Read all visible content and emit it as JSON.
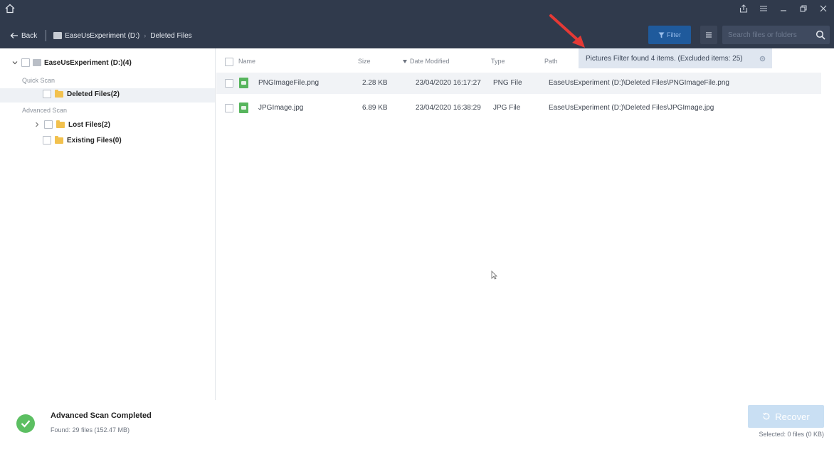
{
  "titlebar": {
    "home_icon": "home-icon",
    "controls": [
      "share-icon",
      "menu-icon",
      "minimize-icon",
      "restore-icon",
      "close-icon"
    ]
  },
  "nav": {
    "back_label": "Back",
    "drive_label": "EaseUsExperiment (D:)",
    "folder_label": "Deleted Files",
    "filter_label": "Filter",
    "search_placeholder": "Search files or folders"
  },
  "banner": {
    "text": "Pictures Filter found 4 items. (Excluded items: 25)"
  },
  "sidebar": {
    "root_label": "EaseUsExperiment (D:)(4)",
    "quick_scan_label": "Quick Scan",
    "deleted_files_label": "Deleted Files(2)",
    "advanced_scan_label": "Advanced Scan",
    "lost_files_label": "Lost Files(2)",
    "existing_files_label": "Existing Files(0)"
  },
  "table": {
    "headers": {
      "name": "Name",
      "size": "Size",
      "date": "Date Modified",
      "type": "Type",
      "path": "Path"
    },
    "rows": [
      {
        "name": "PNGImageFile.png",
        "size": "2.28 KB",
        "date": "23/04/2020 16:17:27",
        "type": "PNG File",
        "path": "EaseUsExperiment (D:)\\Deleted Files\\PNGImageFile.png"
      },
      {
        "name": "JPGImage.jpg",
        "size": "6.89 KB",
        "date": "23/04/2020 16:38:29",
        "type": "JPG File",
        "path": "EaseUsExperiment (D:)\\Deleted Files\\JPGImage.jpg"
      }
    ]
  },
  "status": {
    "title": "Advanced Scan Completed",
    "found": "Found: 29 files (152.47 MB)",
    "recover_label": "Recover",
    "selected": "Selected: 0 files (0 KB)"
  },
  "colors": {
    "titlebar": "#303a4c",
    "accent": "#1f5a9c",
    "success": "#5cbf62",
    "annotation_arrow": "#e53935"
  }
}
